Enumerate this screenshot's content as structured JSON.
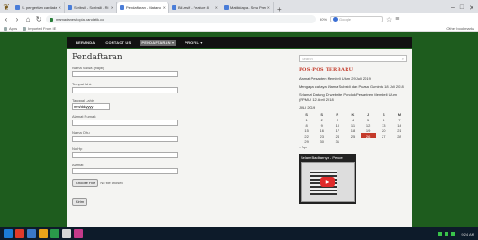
{
  "browser": {
    "tabs": [
      {
        "label": "S. pengertian cardiaks-so",
        "active": false
      },
      {
        "label": "Scribsili - Scribsili - Ri",
        "active": false
      },
      {
        "label": "Pendaftaran - Matamor",
        "active": true
      },
      {
        "label": "Bil.arsif - Feature 8",
        "active": false
      },
      {
        "label": "Matikkiapa - Sma Prem",
        "active": false
      }
    ],
    "url": "mamadaneshopia.bandetik.co",
    "zoom": "90%",
    "search_placeholder": "Google",
    "bookmarks": [
      {
        "label": "Apps"
      },
      {
        "label": "Imported From IE"
      }
    ],
    "other_bookmarks": "Other bookmarks"
  },
  "site": {
    "nav": [
      {
        "label": "BERANDA",
        "active": false
      },
      {
        "label": "CONTACT US",
        "active": false
      },
      {
        "label": "PENDAFTARAN ▾",
        "active": true
      },
      {
        "label": "PROFIL ▾",
        "active": false
      }
    ]
  },
  "form": {
    "title": "Pendaftaran",
    "fields": [
      {
        "label": "Nama Siswa (wajib)",
        "value": ""
      },
      {
        "label": "Tempat lahir",
        "value": ""
      },
      {
        "label": "Tanggal Lahir",
        "value": "mm/dd/yyyy"
      },
      {
        "label": "Alamat Rumah",
        "value": ""
      },
      {
        "label": "Nama Ortu",
        "value": ""
      },
      {
        "label": "No Hp",
        "value": ""
      },
      {
        "label": "Alamat",
        "value": ""
      }
    ],
    "file_button": "Choose File",
    "file_status": "No file chosen",
    "submit": "Kirim"
  },
  "sidebar": {
    "search_placeholder": "Search",
    "recent_title": "POS-POS TERBARU",
    "posts": [
      "Alamat Pesanten Membeli Ulum 29 Juli 2019",
      "Mengapa cahaya Ulama Subsidi dan Puasa Gaminta 18 Juli 2018",
      "Selamat Datang Di website Pondok Pesantren Membeli Ulum (PPMU) 12 April 2018"
    ],
    "calendar": {
      "month": "JULI 2019",
      "days": [
        "S",
        "S",
        "R",
        "K",
        "J",
        "S",
        "M"
      ],
      "weeks": [
        [
          "1",
          "2",
          "3",
          "4",
          "5",
          "6",
          "7"
        ],
        [
          "8",
          "9",
          "10",
          "11",
          "12",
          "13",
          "14"
        ],
        [
          "15",
          "16",
          "17",
          "18",
          "19",
          "20",
          "21"
        ],
        [
          "22",
          "23",
          "24",
          "25",
          "26",
          "27",
          "28"
        ],
        [
          "29",
          "30",
          "31",
          "",
          "",
          "",
          ""
        ]
      ],
      "today": "26",
      "prev": "« Apr"
    },
    "video_title": "Selam Badbarnya - Pence"
  },
  "taskbar": {
    "clock": "9:24 AM"
  }
}
